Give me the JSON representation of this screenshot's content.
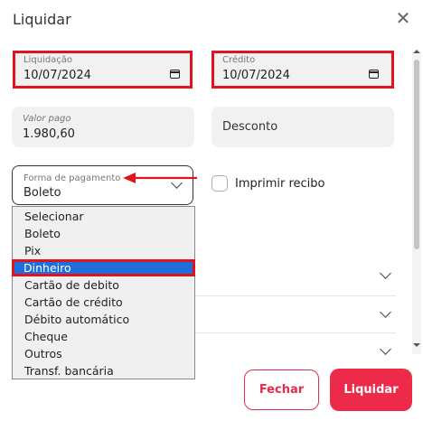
{
  "dialog": {
    "title": "Liquidar"
  },
  "liquidacao": {
    "label": "Liquidação",
    "value": "10/07/2024"
  },
  "credito": {
    "label": "Crédito",
    "value": "10/07/2024"
  },
  "valor_pago": {
    "label": "Valor pago",
    "value": "1.980,60"
  },
  "desconto": {
    "placeholder": "Desconto"
  },
  "forma_pagamento": {
    "label": "Forma de pagamento",
    "value": "Boleto",
    "options": [
      "Selecionar",
      "Boleto",
      "Pix",
      "Dinheiro",
      "Cartão de debito",
      "Cartão de crédito",
      "Débito automático",
      "Cheque",
      "Outros",
      "Transf. bancária"
    ],
    "highlighted": "Dinheiro"
  },
  "imprimir_recibo": {
    "label": "Imprimir recibo",
    "checked": false
  },
  "footer": {
    "fechar_label": "Fechar",
    "liquidar_label": "Liquidar"
  },
  "colors": {
    "accent": "#ee2a4a",
    "highlight": "#e0141e",
    "selection": "#1e6fd9"
  }
}
